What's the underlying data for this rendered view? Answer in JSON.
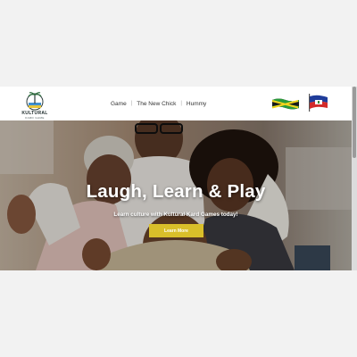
{
  "header": {
    "logo": {
      "title": "KULTURAL",
      "subtitle": "KARD GAME"
    },
    "nav": [
      "Game",
      "The New Chick",
      "Hummy"
    ],
    "flags": [
      "jamaica-flag",
      "haiti-flag"
    ]
  },
  "hero": {
    "title": "Laugh, Learn & Play",
    "subtitle": "Learn culture with Kultural Kard Games today!",
    "button_label": "Learn More"
  },
  "colors": {
    "accent": "#d9bf2a",
    "header_bg": "#ffffff",
    "page_bg": "#f2f2f2"
  }
}
